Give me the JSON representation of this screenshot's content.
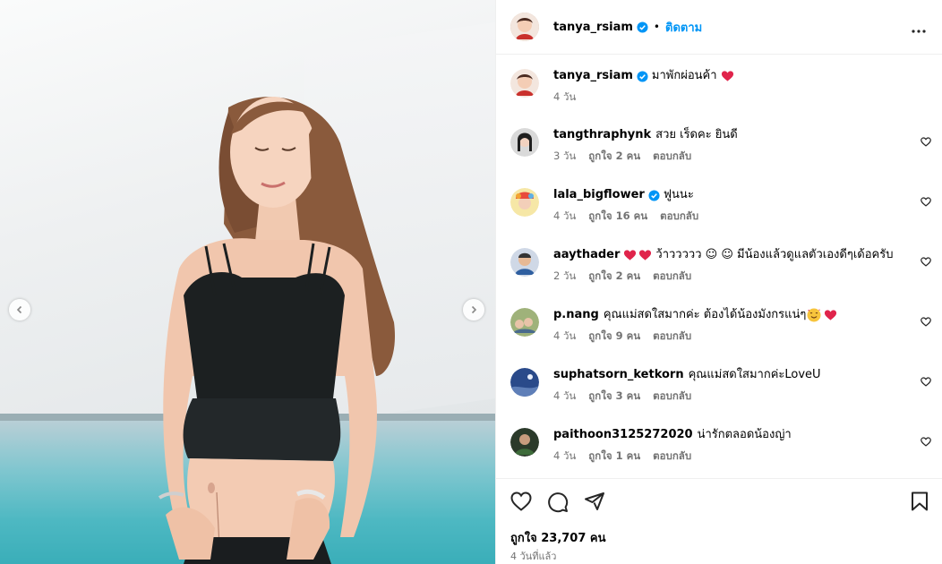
{
  "post_owner": {
    "username": "tanya_rsiam",
    "separator": "•",
    "follow_label": "ติดตาม"
  },
  "caption": {
    "username": "tanya_rsiam",
    "text": "มาพักผ่อนค้า",
    "time": "4 วัน"
  },
  "comments": [
    {
      "username": "tangthraphynk",
      "text": "สวย เร็ดคะ ยินดี",
      "time": "3 วัน",
      "likes": "ถูกใจ 2 คน",
      "reply": "ตอบกลับ",
      "verified": false,
      "avatar_color": "#3b3b3b"
    },
    {
      "username": "lala_bigflower",
      "text": "ฟูนนะ",
      "time": "4 วัน",
      "likes": "ถูกใจ 16 คน",
      "reply": "ตอบกลับ",
      "verified": true,
      "avatar_color": "#e84b3c"
    },
    {
      "username": "aaythader",
      "text": "ว้าววววว ☺ ☺ มีน้องแล้วดูแลตัวเองดีๆเด้อครับ",
      "time": "2 วัน",
      "likes": "ถูกใจ 2 คน",
      "reply": "ตอบกลับ",
      "verified": false,
      "avatar_color": "#2f5fa0"
    },
    {
      "username": "p.nang",
      "text": "คุณแม่สดใสมากค่ะ ต้องได้น้องมังกรแน่ๆ",
      "time": "4 วัน",
      "likes": "ถูกใจ 9 คน",
      "reply": "ตอบกลับ",
      "verified": false,
      "avatar_color": "#6d7d4a"
    },
    {
      "username": "suphatsorn_ketkorn",
      "text": "คุณแม่สดใสมากค่ะLoveU",
      "time": "4 วัน",
      "likes": "ถูกใจ 3 คน",
      "reply": "ตอบกลับ",
      "verified": false,
      "avatar_color": "#2a4a8a"
    },
    {
      "username": "paithoon3125272020",
      "text": "น่ารักตลอดน้องญ่า",
      "time": "4 วัน",
      "likes": "ถูกใจ 1 คน",
      "reply": "ตอบกลับ",
      "verified": false,
      "avatar_color": "#2b3a2a"
    }
  ],
  "footer": {
    "likes": "ถูกใจ 23,707 คน",
    "time": "4 วันที่แล้ว"
  },
  "colors": {
    "accent": "#0095f6",
    "heart_red": "#e0244b",
    "meta_gray": "#737373"
  }
}
